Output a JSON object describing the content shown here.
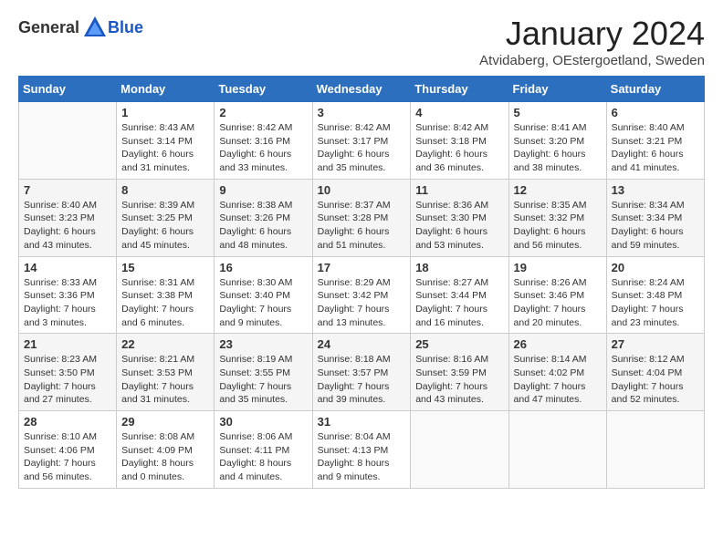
{
  "header": {
    "logo_general": "General",
    "logo_blue": "Blue",
    "title": "January 2024",
    "subtitle": "Atvidaberg, OEstergoetland, Sweden"
  },
  "days_of_week": [
    "Sunday",
    "Monday",
    "Tuesday",
    "Wednesday",
    "Thursday",
    "Friday",
    "Saturday"
  ],
  "weeks": [
    [
      {
        "day": "",
        "info": ""
      },
      {
        "day": "1",
        "info": "Sunrise: 8:43 AM\nSunset: 3:14 PM\nDaylight: 6 hours\nand 31 minutes."
      },
      {
        "day": "2",
        "info": "Sunrise: 8:42 AM\nSunset: 3:16 PM\nDaylight: 6 hours\nand 33 minutes."
      },
      {
        "day": "3",
        "info": "Sunrise: 8:42 AM\nSunset: 3:17 PM\nDaylight: 6 hours\nand 35 minutes."
      },
      {
        "day": "4",
        "info": "Sunrise: 8:42 AM\nSunset: 3:18 PM\nDaylight: 6 hours\nand 36 minutes."
      },
      {
        "day": "5",
        "info": "Sunrise: 8:41 AM\nSunset: 3:20 PM\nDaylight: 6 hours\nand 38 minutes."
      },
      {
        "day": "6",
        "info": "Sunrise: 8:40 AM\nSunset: 3:21 PM\nDaylight: 6 hours\nand 41 minutes."
      }
    ],
    [
      {
        "day": "7",
        "info": "Sunrise: 8:40 AM\nSunset: 3:23 PM\nDaylight: 6 hours\nand 43 minutes."
      },
      {
        "day": "8",
        "info": "Sunrise: 8:39 AM\nSunset: 3:25 PM\nDaylight: 6 hours\nand 45 minutes."
      },
      {
        "day": "9",
        "info": "Sunrise: 8:38 AM\nSunset: 3:26 PM\nDaylight: 6 hours\nand 48 minutes."
      },
      {
        "day": "10",
        "info": "Sunrise: 8:37 AM\nSunset: 3:28 PM\nDaylight: 6 hours\nand 51 minutes."
      },
      {
        "day": "11",
        "info": "Sunrise: 8:36 AM\nSunset: 3:30 PM\nDaylight: 6 hours\nand 53 minutes."
      },
      {
        "day": "12",
        "info": "Sunrise: 8:35 AM\nSunset: 3:32 PM\nDaylight: 6 hours\nand 56 minutes."
      },
      {
        "day": "13",
        "info": "Sunrise: 8:34 AM\nSunset: 3:34 PM\nDaylight: 6 hours\nand 59 minutes."
      }
    ],
    [
      {
        "day": "14",
        "info": "Sunrise: 8:33 AM\nSunset: 3:36 PM\nDaylight: 7 hours\nand 3 minutes."
      },
      {
        "day": "15",
        "info": "Sunrise: 8:31 AM\nSunset: 3:38 PM\nDaylight: 7 hours\nand 6 minutes."
      },
      {
        "day": "16",
        "info": "Sunrise: 8:30 AM\nSunset: 3:40 PM\nDaylight: 7 hours\nand 9 minutes."
      },
      {
        "day": "17",
        "info": "Sunrise: 8:29 AM\nSunset: 3:42 PM\nDaylight: 7 hours\nand 13 minutes."
      },
      {
        "day": "18",
        "info": "Sunrise: 8:27 AM\nSunset: 3:44 PM\nDaylight: 7 hours\nand 16 minutes."
      },
      {
        "day": "19",
        "info": "Sunrise: 8:26 AM\nSunset: 3:46 PM\nDaylight: 7 hours\nand 20 minutes."
      },
      {
        "day": "20",
        "info": "Sunrise: 8:24 AM\nSunset: 3:48 PM\nDaylight: 7 hours\nand 23 minutes."
      }
    ],
    [
      {
        "day": "21",
        "info": "Sunrise: 8:23 AM\nSunset: 3:50 PM\nDaylight: 7 hours\nand 27 minutes."
      },
      {
        "day": "22",
        "info": "Sunrise: 8:21 AM\nSunset: 3:53 PM\nDaylight: 7 hours\nand 31 minutes."
      },
      {
        "day": "23",
        "info": "Sunrise: 8:19 AM\nSunset: 3:55 PM\nDaylight: 7 hours\nand 35 minutes."
      },
      {
        "day": "24",
        "info": "Sunrise: 8:18 AM\nSunset: 3:57 PM\nDaylight: 7 hours\nand 39 minutes."
      },
      {
        "day": "25",
        "info": "Sunrise: 8:16 AM\nSunset: 3:59 PM\nDaylight: 7 hours\nand 43 minutes."
      },
      {
        "day": "26",
        "info": "Sunrise: 8:14 AM\nSunset: 4:02 PM\nDaylight: 7 hours\nand 47 minutes."
      },
      {
        "day": "27",
        "info": "Sunrise: 8:12 AM\nSunset: 4:04 PM\nDaylight: 7 hours\nand 52 minutes."
      }
    ],
    [
      {
        "day": "28",
        "info": "Sunrise: 8:10 AM\nSunset: 4:06 PM\nDaylight: 7 hours\nand 56 minutes."
      },
      {
        "day": "29",
        "info": "Sunrise: 8:08 AM\nSunset: 4:09 PM\nDaylight: 8 hours\nand 0 minutes."
      },
      {
        "day": "30",
        "info": "Sunrise: 8:06 AM\nSunset: 4:11 PM\nDaylight: 8 hours\nand 4 minutes."
      },
      {
        "day": "31",
        "info": "Sunrise: 8:04 AM\nSunset: 4:13 PM\nDaylight: 8 hours\nand 9 minutes."
      },
      {
        "day": "",
        "info": ""
      },
      {
        "day": "",
        "info": ""
      },
      {
        "day": "",
        "info": ""
      }
    ]
  ]
}
